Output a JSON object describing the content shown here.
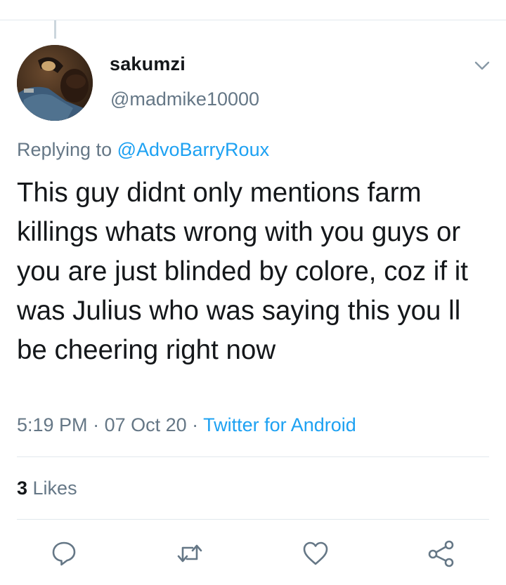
{
  "tweet": {
    "display_name": "sakumzi",
    "handle": "@madmike10000",
    "replying_prefix": "Replying to ",
    "replying_to": "@AdvoBarryRoux",
    "text": "This guy didnt only mentions farm killings whats wrong with you guys or you are just blinded by colore, coz if it was Julius who was saying this you ll be cheering right now",
    "time": "5:19 PM",
    "sep1": " · ",
    "date": "07 Oct 20",
    "sep2": " · ",
    "source": "Twitter for Android"
  },
  "stats": {
    "likes_count": "3",
    "likes_label": " Likes"
  },
  "actions": [
    {
      "name": "reply",
      "icon": "reply-icon"
    },
    {
      "name": "retweet",
      "icon": "retweet-icon"
    },
    {
      "name": "like",
      "icon": "heart-icon"
    },
    {
      "name": "share",
      "icon": "share-icon"
    }
  ],
  "colors": {
    "text": "#14171a",
    "secondary": "#657786",
    "accent": "#1da1f2",
    "divider": "#e1e8ed"
  }
}
